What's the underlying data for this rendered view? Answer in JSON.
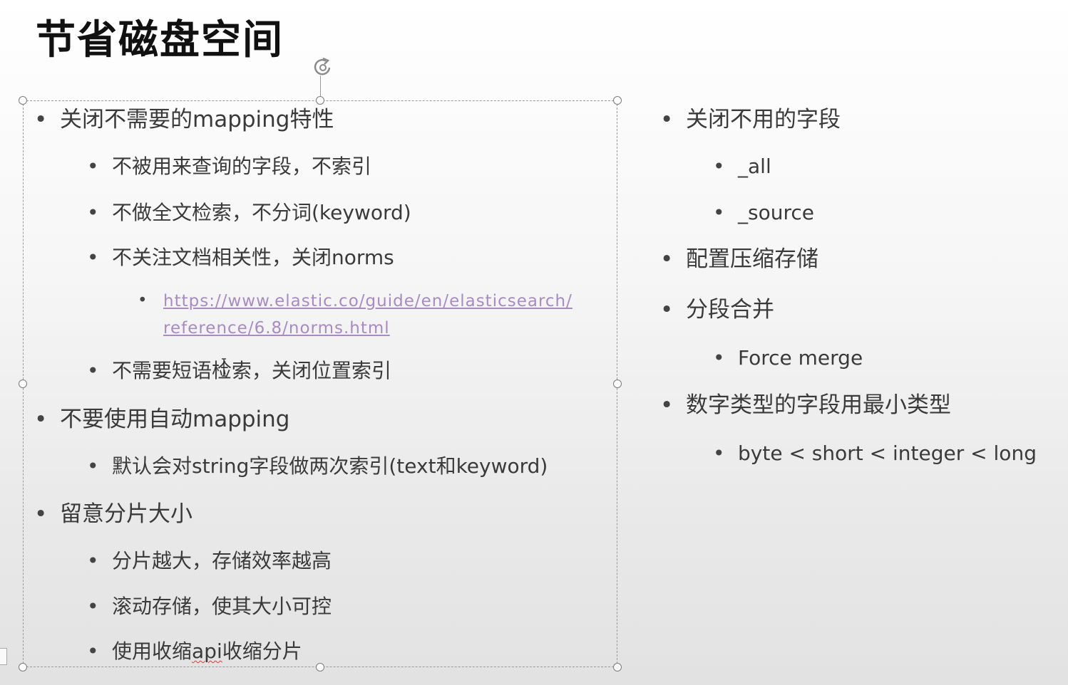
{
  "title": "节省磁盘空间",
  "left": {
    "s1": {
      "label": "关闭不需要的mapping特性",
      "sub1": "不被用来查询的字段，不索引",
      "sub2": "不做全文检索，不分词(keyword)",
      "sub3": "不关注文档相关性，关闭norms",
      "link_line1": "https://www.elastic.co/guide/en/elasticsearch/",
      "link_line2": "reference/6.8/norms.html",
      "sub4": "不需要短语检索，关闭位置索引"
    },
    "s2": {
      "label": "不要使用自动mapping",
      "sub1": "默认会对string字段做两次索引(text和keyword)"
    },
    "s3": {
      "label": "留意分片大小",
      "sub1": "分片越大，存储效率越高",
      "sub2": "滚动存储，使其大小可控",
      "sub3_prefix": "使用收缩",
      "sub3_api": "api",
      "sub3_suffix": "收缩分片"
    }
  },
  "right": {
    "s1": {
      "label": "关闭不用的字段",
      "sub1": "_all",
      "sub2": "_source"
    },
    "s2": {
      "label": "配置压缩存储"
    },
    "s3": {
      "label": "分段合并",
      "sub1": "Force merge"
    },
    "s4": {
      "label": "数字类型的字段用最小类型",
      "sub1": "byte < short < integer < long"
    }
  },
  "bullet": "•",
  "colors": {
    "link": "#a88bc3",
    "title": "#111111",
    "text": "#3a3a3a"
  },
  "icons": {
    "rotate": "rotate-handle-icon",
    "cursor": "text-cursor-icon"
  }
}
